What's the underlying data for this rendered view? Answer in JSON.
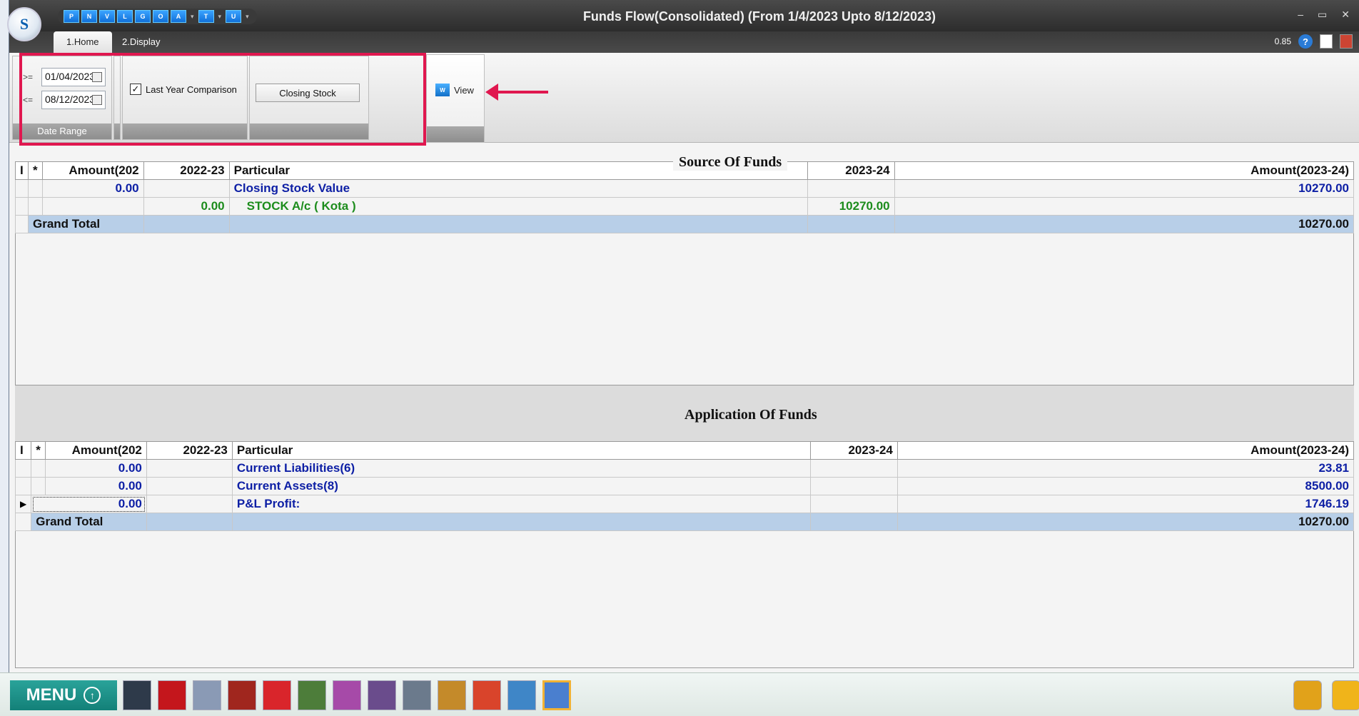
{
  "window": {
    "title": "Funds Flow(Consolidated) (From 1/4/2023 Upto 8/12/2023)",
    "logo_letter": "S",
    "minimize": "–",
    "maximize": "▭",
    "close": "✕"
  },
  "quick_access": [
    {
      "label": "P",
      "name": "qa-p-button"
    },
    {
      "label": "N",
      "name": "qa-n-button"
    },
    {
      "label": "V",
      "name": "qa-v-button"
    },
    {
      "label": "L",
      "name": "qa-l-button"
    },
    {
      "label": "G",
      "name": "qa-g-button"
    },
    {
      "label": "O",
      "name": "qa-o-button"
    },
    {
      "label": "A",
      "name": "qa-a-button"
    },
    {
      "label": "T",
      "name": "qa-t-button"
    },
    {
      "label": "U",
      "name": "qa-u-button"
    }
  ],
  "tabs": {
    "home": "1.Home",
    "display": "2.Display"
  },
  "tabbar_right": {
    "version": "0.85",
    "help": "?"
  },
  "ribbon": {
    "date_range": {
      "from_op": ">=",
      "from_value": "01/04/2023",
      "to_op": "<=",
      "to_value": "08/12/2023",
      "caption": "Date Range"
    },
    "last_year_comparison": {
      "label": "Last Year Comparison",
      "checked": "✓"
    },
    "closing_stock_button": "Closing Stock",
    "view_button": "View",
    "view_icon_text": "W"
  },
  "source_of_funds": {
    "title": "Source Of Funds",
    "headers": {
      "i": "I",
      "star": "*",
      "amount_prev": "Amount(202",
      "year_prev": "2022-23",
      "particular": "Particular",
      "year_cur": "2023-24",
      "amount_cur": "Amount(2023-24)"
    },
    "rows": [
      {
        "amount_prev": "0.00",
        "year_prev": "",
        "particular": "Closing Stock Value",
        "year_cur": "",
        "amount_cur": "10270.00",
        "style": "blue"
      },
      {
        "amount_prev": "",
        "year_prev": "0.00",
        "particular": "STOCK A/c ( Kota )",
        "year_cur": "10270.00",
        "amount_cur": "",
        "style": "green"
      }
    ],
    "grand_total": {
      "label": "Grand Total",
      "amount_cur": "10270.00"
    }
  },
  "application_of_funds": {
    "title": "Application Of Funds",
    "headers": {
      "i": "I",
      "star": "*",
      "amount_prev": "Amount(202",
      "year_prev": "2022-23",
      "particular": "Particular",
      "year_cur": "2023-24",
      "amount_cur": "Amount(2023-24)"
    },
    "rows": [
      {
        "amount_prev": "0.00",
        "year_prev": "",
        "particular": "Current Liabilities(6)",
        "year_cur": "",
        "amount_cur": "23.81"
      },
      {
        "amount_prev": "0.00",
        "year_prev": "",
        "particular": "Current Assets(8)",
        "year_cur": "",
        "amount_cur": "8500.00"
      },
      {
        "amount_prev": "0.00",
        "year_prev": "",
        "particular": "P&L Profit:",
        "year_cur": "",
        "amount_cur": "1746.19",
        "current": "▶"
      }
    ],
    "grand_total": {
      "label": "Grand Total",
      "amount_cur": "10270.00"
    }
  },
  "taskbar": {
    "menu_label": "MENU",
    "menu_icon": "↑",
    "icons": [
      {
        "name": "taskbar-ledger-icon",
        "color": "#2e3a4a"
      },
      {
        "name": "taskbar-p-red-icon",
        "color": "#c4161c"
      },
      {
        "name": "taskbar-bottle-icon",
        "color": "#8a9ab5"
      },
      {
        "name": "taskbar-car-icon",
        "color": "#a0261e"
      },
      {
        "name": "taskbar-p-box-icon",
        "color": "#d9252b"
      },
      {
        "name": "taskbar-re-icon",
        "color": "#4d7d3a"
      },
      {
        "name": "taskbar-pe-icon",
        "color": "#a64aa8"
      },
      {
        "name": "taskbar-stamp-icon",
        "color": "#6a4c8c"
      },
      {
        "name": "taskbar-barcode-icon",
        "color": "#6b7a8c"
      },
      {
        "name": "taskbar-moneybag-icon",
        "color": "#c48a2a"
      },
      {
        "name": "taskbar-shapes-icon",
        "color": "#d9442b"
      },
      {
        "name": "taskbar-printer-icon",
        "color": "#3f86c7"
      },
      {
        "name": "taskbar-documents-icon",
        "color": "#4a7fcf"
      }
    ],
    "right_icons": [
      {
        "name": "taskbar-megaphone-icon",
        "color": "#e1a21a"
      },
      {
        "name": "taskbar-bell-icon",
        "color": "#f0b41a"
      }
    ]
  }
}
